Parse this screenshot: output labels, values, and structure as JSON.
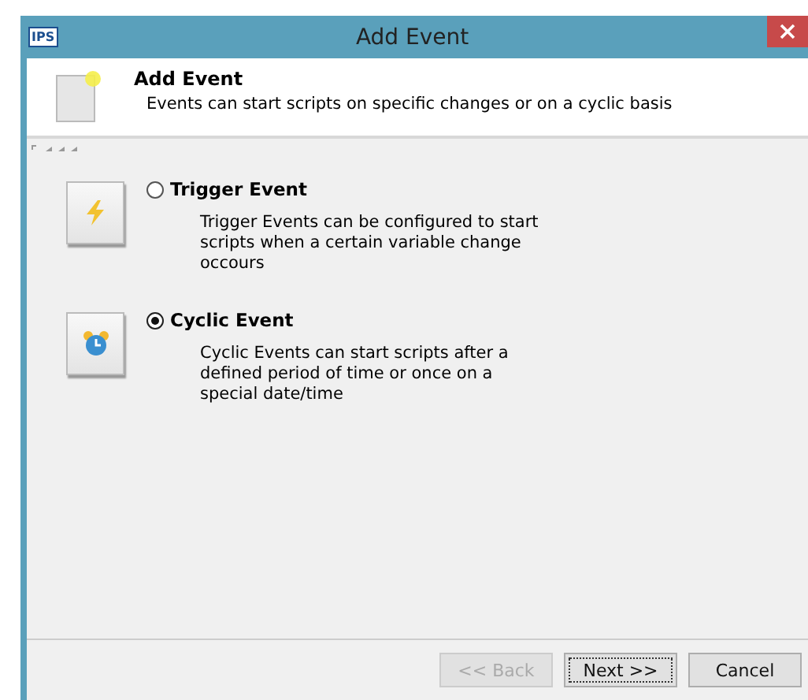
{
  "window": {
    "app_badge": "IPS",
    "title": "Add Event"
  },
  "header": {
    "title": "Add Event",
    "subtitle": "Events can start scripts on specific changes or on a cyclic basis"
  },
  "options": [
    {
      "kind": "trigger",
      "label": "Trigger Event",
      "selected": false,
      "description": "Trigger Events can be configured to start scripts when a certain variable change occours"
    },
    {
      "kind": "cyclic",
      "label": "Cyclic Event",
      "selected": true,
      "description": "Cyclic Events can start scripts after a defined period of time or once on a special date/time"
    }
  ],
  "buttons": [
    {
      "label": "<< Back",
      "disabled": true,
      "focused": false
    },
    {
      "label": "Next >>",
      "disabled": false,
      "focused": true
    },
    {
      "label": "Cancel",
      "disabled": false,
      "focused": false
    }
  ]
}
